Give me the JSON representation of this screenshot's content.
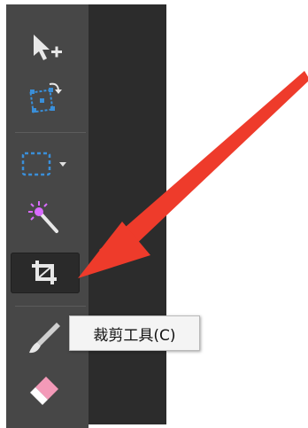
{
  "toolbar": {
    "tools": [
      {
        "icon": "move-add-arrow-icon"
      },
      {
        "icon": "transform-rotate-icon"
      },
      {
        "icon": "rectangular-marquee-icon",
        "has_dropdown": true
      },
      {
        "icon": "magic-wand-icon"
      },
      {
        "icon": "crop-icon",
        "active": true
      },
      {
        "icon": "brush-icon"
      },
      {
        "icon": "eraser-icon"
      }
    ]
  },
  "tooltip": {
    "text": "裁剪工具(C)"
  },
  "annotation": {
    "arrow_color": "#ee3b2b"
  },
  "colors": {
    "toolbar_bg": "#474747",
    "panel_bg": "#2c2c2c",
    "accent_blue": "#3a8fd9",
    "wand_purple": "#d86bff"
  }
}
